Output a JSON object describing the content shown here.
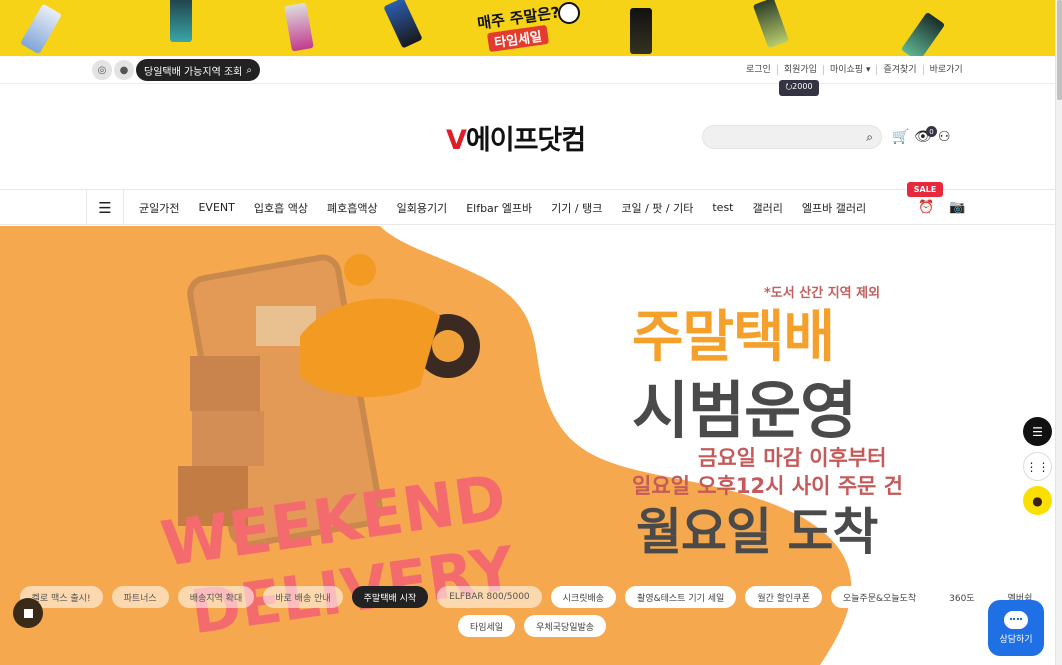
{
  "top_banner": {
    "line1": "매주 주말은?",
    "line2": "타임세일",
    "colors": {
      "bg": "#f7d318",
      "accent": "#e33b2e"
    }
  },
  "util_bar": {
    "sns": [
      "instagram-icon",
      "kakaotalk-icon"
    ],
    "today_delivery_button": "당일택배 가능지역 조회",
    "links": [
      "로그인",
      "회원가입",
      "마이쇼핑 ▾",
      "즐겨찾기",
      "바로가기"
    ],
    "point_badge": "⭮2000"
  },
  "header": {
    "logo_v": "V",
    "logo_rest": "에이프닷컴",
    "search_placeholder": "",
    "view_count": "0"
  },
  "nav": {
    "items": [
      "균일가전",
      "EVENT",
      "입호흡 액상",
      "폐호흡액상",
      "일회용기기",
      "Elfbar 엘프바",
      "기기 / 탱크",
      "코일 / 팟 / 기타",
      "test",
      "갤러리",
      "엘프바 갤러리"
    ],
    "sale_badge": "SALE"
  },
  "hero": {
    "note": "*도서 산간 지역 제외",
    "line1": "주말택배",
    "line2": "시범운영",
    "line3": "금요일 마감 이후부터",
    "line4": "일요일 오후12시 사이 주문 건",
    "line5": "월요일 도착",
    "deco1": "WEEKEND",
    "deco2": "DELIVERY"
  },
  "chips": [
    {
      "label": "켈로 맥스 출시!",
      "state": "normal"
    },
    {
      "label": "파트너스",
      "state": "normal"
    },
    {
      "label": "배송지역 확대",
      "state": "normal"
    },
    {
      "label": "바로 배송 안내",
      "state": "normal"
    },
    {
      "label": "주말택배 시작",
      "state": "active"
    },
    {
      "label": "ELFBAR 800/5000",
      "state": "normal"
    },
    {
      "label": "시크릿배송",
      "state": "white"
    },
    {
      "label": "촬영&테스트 기기 세일",
      "state": "white"
    },
    {
      "label": "월간 할인쿠폰",
      "state": "white"
    },
    {
      "label": "오늘주문&오늘도착",
      "state": "white"
    },
    {
      "label": "360도",
      "state": "white"
    },
    {
      "label": "멤버쉽",
      "state": "white"
    },
    {
      "label": "타임세일",
      "state": "white"
    },
    {
      "label": "우체국당일발송",
      "state": "white"
    }
  ],
  "floating": {
    "consult_label": "상담하기"
  }
}
